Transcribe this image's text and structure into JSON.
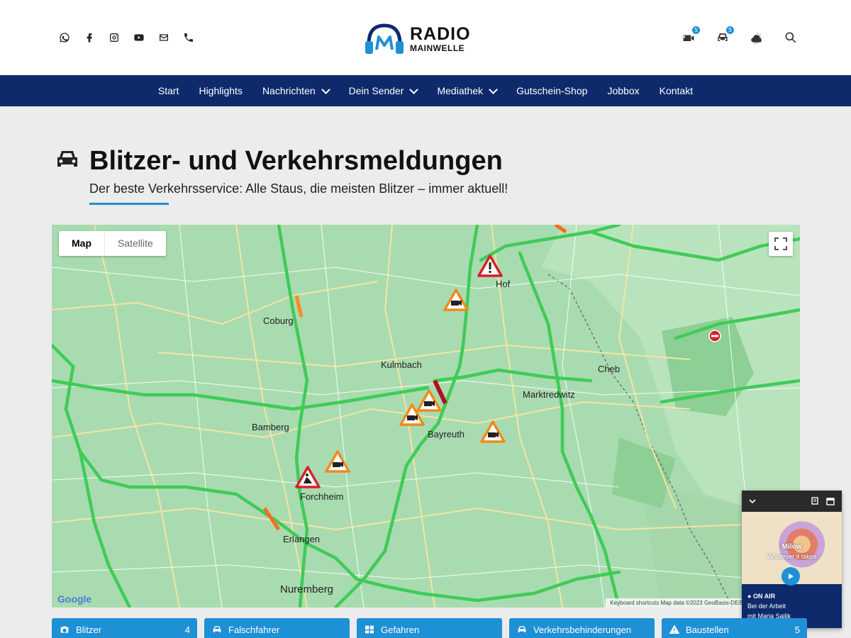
{
  "header": {
    "social_icons": [
      "whatsapp-icon",
      "facebook-icon",
      "instagram-icon",
      "youtube-icon",
      "mail-icon",
      "phone-icon"
    ],
    "logo_line1": "RADIO",
    "logo_line2": "MAINWELLE",
    "right_icons": [
      {
        "name": "speed-camera-icon",
        "badge": "5"
      },
      {
        "name": "car-icon",
        "badge": "5"
      },
      {
        "name": "weather-icon",
        "badge": ""
      },
      {
        "name": "search-icon",
        "badge": ""
      }
    ]
  },
  "nav": {
    "items": [
      {
        "label": "Start",
        "dropdown": false
      },
      {
        "label": "Highlights",
        "dropdown": false
      },
      {
        "label": "Nachrichten",
        "dropdown": true
      },
      {
        "label": "Dein Sender",
        "dropdown": true
      },
      {
        "label": "Mediathek",
        "dropdown": true
      },
      {
        "label": "Gutschein-Shop",
        "dropdown": false
      },
      {
        "label": "Jobbox",
        "dropdown": false
      },
      {
        "label": "Kontakt",
        "dropdown": false
      }
    ]
  },
  "page": {
    "title": "Blitzer- und Verkehrsmeldungen",
    "subtitle": "Der beste Verkehrsservice: Alle Staus, die meisten Blitzer – immer aktuell!"
  },
  "map": {
    "tab_map": "Map",
    "tab_satellite": "Satellite",
    "google": "Google",
    "attribution": "Keyboard shortcuts   Map data ©2023 GeoBasis-DE/BKG (©2009), Google",
    "cities": [
      "Nuremberg",
      "Bayreuth",
      "Bamberg",
      "Coburg",
      "Hof",
      "Erlangen",
      "Kulmbach",
      "Forchheim",
      "Cheb",
      "Marktredwitz"
    ]
  },
  "player": {
    "artist": "Milow",
    "song": "Whatever it takes",
    "onair_label": "ON AIR",
    "show": "Bei der Arbeit",
    "host": "mit Maria Sailik"
  },
  "categories": [
    {
      "label": "Blitzer",
      "count": "4",
      "icon": "camera-icon"
    },
    {
      "label": "Falschfahrer",
      "count": "",
      "icon": "car-icon"
    },
    {
      "label": "Gefahren",
      "count": "",
      "icon": "hazard-icon"
    },
    {
      "label": "Verkehrsbehinderungen",
      "count": "",
      "icon": "car-icon"
    },
    {
      "label": "Baustellen",
      "count": "5",
      "icon": "warning-icon"
    }
  ],
  "colors": {
    "nav_bg": "#0e2a6b",
    "accent": "#1e90d6",
    "map_green": "#a9dbb0",
    "road_green": "#3fcb57",
    "marker_orange": "#f08a1c",
    "marker_red": "#d9202a"
  }
}
